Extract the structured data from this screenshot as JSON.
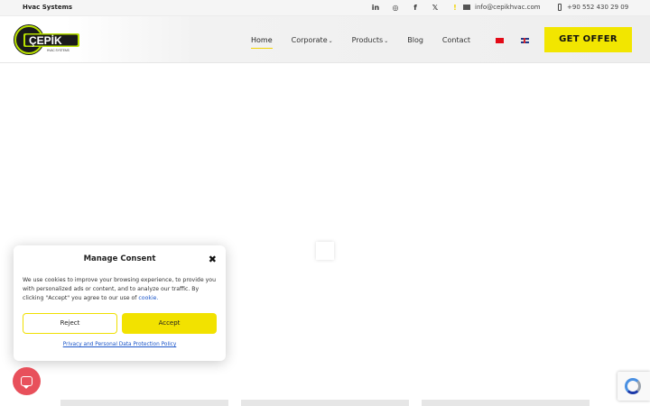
{
  "topbar": {
    "tagline": "Hvac Systems",
    "socials": [
      {
        "icon": "linkedin-icon",
        "glyph": "in"
      },
      {
        "icon": "instagram-icon",
        "glyph": "◎"
      },
      {
        "icon": "facebook-icon",
        "glyph": "f"
      },
      {
        "icon": "x-icon",
        "glyph": "𝕏"
      },
      {
        "icon": "exclamation-icon",
        "glyph": "!"
      }
    ],
    "email": "info@cepikhvac.com",
    "phone": "+90 552 430 29 09"
  },
  "header": {
    "logo_text": "ÇEPİK",
    "logo_sub": "HVAC SYSTEMS",
    "nav": [
      {
        "label": "Home",
        "active": true
      },
      {
        "label": "Corporate",
        "dropdown": true
      },
      {
        "label": "Products",
        "dropdown": true
      },
      {
        "label": "Blog"
      },
      {
        "label": "Contact"
      }
    ],
    "cta": "GET OFFER"
  },
  "consent": {
    "title": "Manage Consent",
    "message": "We use cookies to improve your browsing experience, to provide you with personalized ads or content, and to analyze our traffic. By clicking \"Accept\" you agree to our use of",
    "cookie_link": "cookie.",
    "reject": "Reject",
    "accept": "Accept",
    "policy": "Privacy and Personal Data Protection Policy"
  },
  "colors": {
    "accent": "#f2e600",
    "link": "#1a55c9",
    "chat": "#e8505b"
  }
}
